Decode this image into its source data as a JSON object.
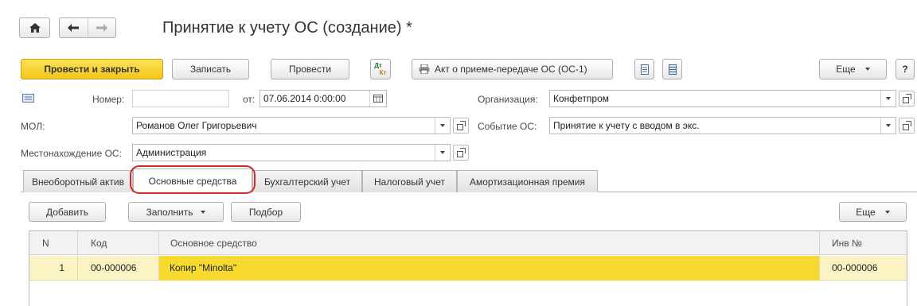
{
  "title": "Принятие к учету ОС (создание) *",
  "toolbar": {
    "post_close": "Провести и закрыть",
    "save": "Записать",
    "post": "Провести",
    "dtkt_top": "Дт",
    "dtkt_bottom": "Кт",
    "print_act": "Акт о приеме-передаче ОС (ОС-1)",
    "more": "Еще",
    "help": "?"
  },
  "form": {
    "number_label": "Номер:",
    "number_value": "",
    "date_label": "от:",
    "date_value": "07.06.2014  0:00:00",
    "org_label": "Организация:",
    "org_value": "Конфетпром",
    "mol_label": "МОЛ:",
    "mol_value": "Романов Олег Григорьевич",
    "event_label": "Событие ОС:",
    "event_value": "Принятие к учету с вводом в экс.",
    "location_label": "Местонахождение ОС:",
    "location_value": "Администрация"
  },
  "tabs": [
    {
      "label": "Внеоборотный актив"
    },
    {
      "label": "Основные средства"
    },
    {
      "label": "Бухгалтерский учет"
    },
    {
      "label": "Налоговый учет"
    },
    {
      "label": "Амортизационная премия"
    }
  ],
  "table_toolbar": {
    "add": "Добавить",
    "fill": "Заполнить",
    "pick": "Подбор",
    "more": "Еще"
  },
  "table": {
    "columns": [
      "N",
      "Код",
      "Основное средство",
      "Инв №"
    ],
    "rows": [
      {
        "n": "1",
        "code": "00-000006",
        "asset": "Копир \"Minolta\"",
        "inv": "00-000006"
      }
    ]
  },
  "colors": {
    "primary_button": "#f7d22e",
    "selected_row": "#f8d930",
    "row_light": "#fbf3c4",
    "highlight_oval": "#d42a2a"
  }
}
